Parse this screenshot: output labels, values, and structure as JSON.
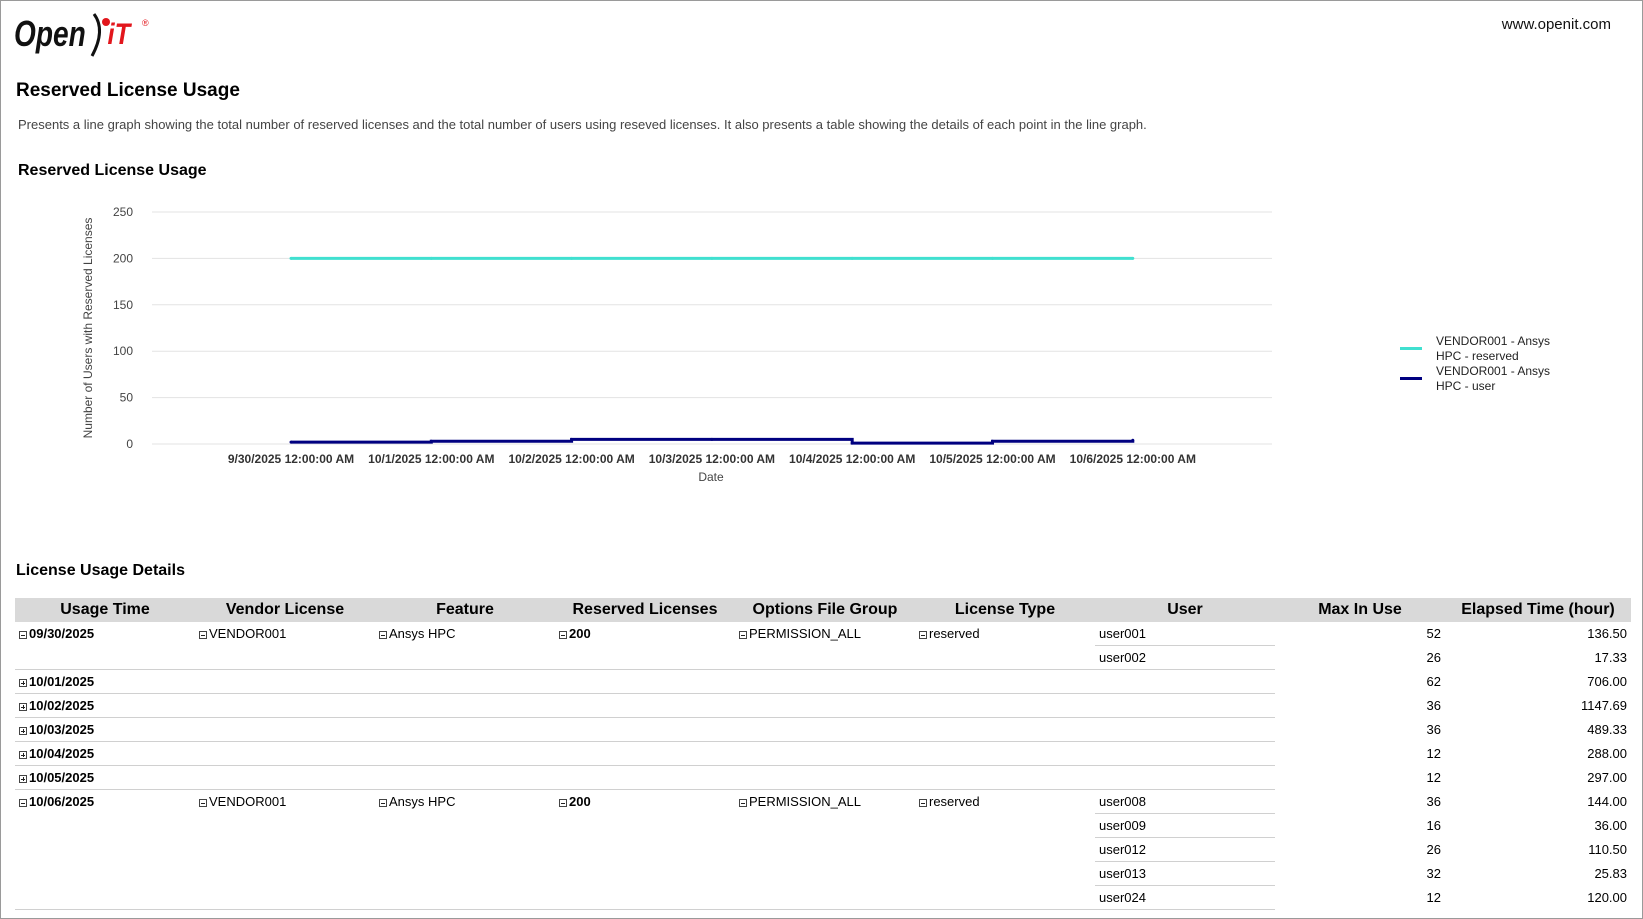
{
  "header": {
    "logo_text": "Open iT",
    "site": "www.openit.com"
  },
  "page": {
    "title": "Reserved License Usage",
    "description": "Presents a line graph showing the total number of reserved licenses and the total number of users using reseved licenses. It also presents a table showing the details of each point in the line graph."
  },
  "chart_data": {
    "type": "line",
    "title": "Reserved License Usage",
    "xlabel": "Date",
    "ylabel": "Number of Users with Reserved Licenses",
    "ylim": [
      0,
      250
    ],
    "yticks": [
      0,
      50,
      100,
      150,
      200,
      250
    ],
    "categories": [
      "9/30/2025 12:00:00 AM",
      "10/1/2025 12:00:00 AM",
      "10/2/2025 12:00:00 AM",
      "10/3/2025 12:00:00 AM",
      "10/4/2025 12:00:00 AM",
      "10/5/2025 12:00:00 AM",
      "10/6/2025 12:00:00 AM"
    ],
    "grid": true,
    "legend_position": "right",
    "series": [
      {
        "name": "VENDOR001 - Ansys HPC - reserved",
        "color": "#40e0d0",
        "step": false,
        "values": [
          200,
          200,
          200,
          200,
          200,
          200,
          200
        ]
      },
      {
        "name": "VENDOR001 - Ansys HPC - user",
        "color": "#000080",
        "step": true,
        "values": [
          2,
          3,
          5,
          5,
          1,
          3,
          4
        ]
      }
    ]
  },
  "details": {
    "title": "License Usage Details",
    "columns": [
      "Usage Time",
      "Vendor License",
      "Feature",
      "Reserved Licenses",
      "Options File Group",
      "License Type",
      "User",
      "Max In Use",
      "Elapsed Time (hour)"
    ],
    "groups": [
      {
        "date": "09/30/2025",
        "expanded": true,
        "vendor": "VENDOR001",
        "feature": "Ansys HPC",
        "reserved": "200",
        "group": "PERMISSION_ALL",
        "type": "reserved",
        "rows": [
          {
            "user": "user001",
            "max": "52",
            "elapsed": "136.50"
          },
          {
            "user": "user002",
            "max": "26",
            "elapsed": "17.33"
          }
        ]
      },
      {
        "date": "10/01/2025",
        "expanded": false,
        "rows": [
          {
            "user": "",
            "max": "62",
            "elapsed": "706.00"
          }
        ]
      },
      {
        "date": "10/02/2025",
        "expanded": false,
        "rows": [
          {
            "user": "",
            "max": "36",
            "elapsed": "1147.69"
          }
        ]
      },
      {
        "date": "10/03/2025",
        "expanded": false,
        "rows": [
          {
            "user": "",
            "max": "36",
            "elapsed": "489.33"
          }
        ]
      },
      {
        "date": "10/04/2025",
        "expanded": false,
        "rows": [
          {
            "user": "",
            "max": "12",
            "elapsed": "288.00"
          }
        ]
      },
      {
        "date": "10/05/2025",
        "expanded": false,
        "rows": [
          {
            "user": "",
            "max": "12",
            "elapsed": "297.00"
          }
        ]
      },
      {
        "date": "10/06/2025",
        "expanded": true,
        "vendor": "VENDOR001",
        "feature": "Ansys HPC",
        "reserved": "200",
        "group": "PERMISSION_ALL",
        "type": "reserved",
        "rows": [
          {
            "user": "user008",
            "max": "36",
            "elapsed": "144.00"
          },
          {
            "user": "user009",
            "max": "16",
            "elapsed": "36.00"
          },
          {
            "user": "user012",
            "max": "26",
            "elapsed": "110.50"
          },
          {
            "user": "user013",
            "max": "32",
            "elapsed": "25.83"
          },
          {
            "user": "user024",
            "max": "12",
            "elapsed": "120.00"
          }
        ]
      }
    ]
  }
}
